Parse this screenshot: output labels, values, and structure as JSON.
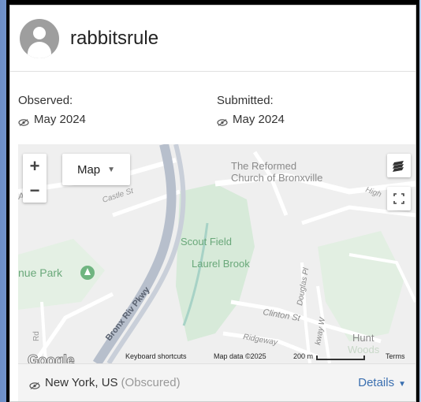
{
  "user": {
    "name": "rabbitsrule"
  },
  "observed": {
    "label": "Observed:",
    "value": "May 2024"
  },
  "submitted": {
    "label": "Submitted:",
    "value": "May 2024"
  },
  "map": {
    "type_label": "Map",
    "zoom_in": "+",
    "zoom_out": "−",
    "labels": {
      "church_1": "The Reformed",
      "church_2": "Church of Bronxville",
      "scout": "Scout Field",
      "laurel": "Laurel Brook",
      "park": "nue Park",
      "castle": "Castle St",
      "parkway": "Bronx Riv Pkwy",
      "clinton": "Clinton St",
      "douglas": "Douglas Pl",
      "ridgeway": "Ridgeway",
      "hunt": "Hunt",
      "woods": "Woods",
      "high": "High",
      "rd": "Rd",
      "a_letter": "A",
      "kway": "kway W"
    },
    "attribution": {
      "google": "Google",
      "shortcuts": "Keyboard shortcuts",
      "data": "Map data ©2025",
      "scale": "200 m",
      "terms": "Terms"
    }
  },
  "place": {
    "name": "New York, US",
    "status": "(Obscured)",
    "details_label": "Details"
  },
  "colors": {
    "link": "#3a6fb0",
    "green": "#cfe8d2",
    "road": "#ffffff",
    "highway": "#b7bfcc"
  }
}
